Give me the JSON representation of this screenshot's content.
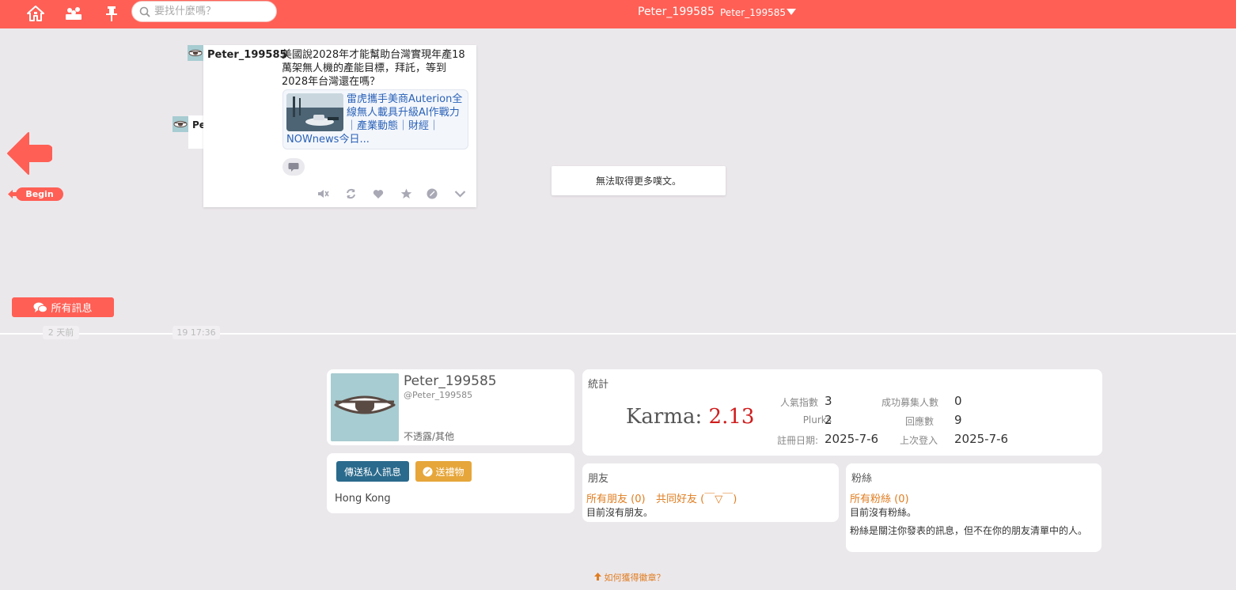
{
  "header": {
    "search_placeholder": "要找什麼嗎？",
    "display_name": "Peter_199585",
    "user_menu": "Peter_199585",
    "icons": [
      "home-icon",
      "friends-icon",
      "pin-icon",
      "search-icon",
      "caret-down-icon"
    ]
  },
  "timeline": {
    "plurk": {
      "author": "Peter_199585",
      "content": "美國說2028年才能幫助台灣實現年產18萬架無人機的產能目標，拜託，等到2028年台灣還在嗎？",
      "link_title": "雷虎攜手美商Auterion全線無人載具升級AI作戰力｜產業動態｜財經｜",
      "link_source": "NOWnews今日..."
    },
    "hidden_author_peek": "Pe",
    "no_more": "無法取得更多噗文。",
    "begin_label": "Begin",
    "all_messages": "所有訊息",
    "time_labels": [
      "2 天前",
      "19 17:36"
    ]
  },
  "profile": {
    "name": "Peter_199585",
    "handle": "@Peter_199585",
    "gender": "不透露/其他",
    "send_pm": "傳送私人訊息",
    "send_gift": "送禮物",
    "location": "Hong Kong"
  },
  "stats": {
    "title": "統計",
    "karma_label": "Karma:",
    "karma_value": "2.13",
    "popularity_label": "人氣指數",
    "popularity_value": "3",
    "plurks_label": "Plurks",
    "plurks_value": "2",
    "joined_label": "註冊日期:",
    "joined_value": "2025-7-6",
    "recruited_label": "成功募集人數",
    "recruited_value": "0",
    "responses_label": "回應數",
    "responses_value": "9",
    "last_login_label": "上次登入",
    "last_login_value": "2025-7-6"
  },
  "friends": {
    "title": "朋友",
    "all_friends": "所有朋友 (0)",
    "mutual": "共同好友 (￣▽￣)",
    "empty": "目前沒有朋友。"
  },
  "fans": {
    "title": "粉絲",
    "all_fans": "所有粉絲 (0)",
    "empty": "目前沒有粉絲。",
    "desc": "粉絲是關注你發表的訊息，但不在你的朋友清單中的人。"
  },
  "footer": {
    "badge_link": "如何獲得徽章？"
  },
  "colors": {
    "brand": "#ff5f55",
    "pm_button": "#2a6a8c",
    "gift_button": "#e6a63a",
    "karma": "#d01c1c",
    "link": "#2a62b8",
    "orange_link": "#e07d20"
  }
}
